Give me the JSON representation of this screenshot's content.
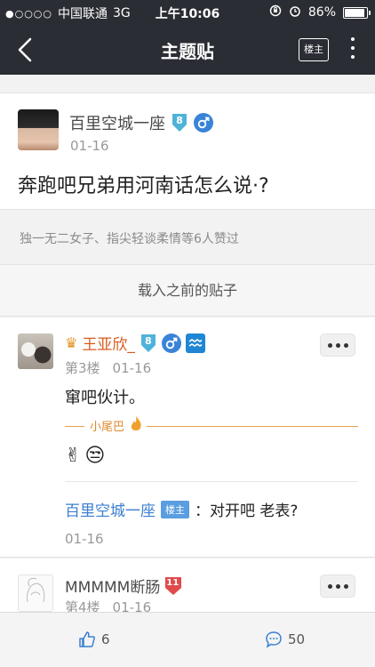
{
  "status": {
    "carrier": "中国联通",
    "network": "3G",
    "time": "上午10:06",
    "battery_text": "86%",
    "battery_level": 0.86
  },
  "nav": {
    "title": "主题贴",
    "owner_button": "楼主"
  },
  "post": {
    "author": "百里空城一座",
    "level": "8",
    "date": "01-16",
    "title": "奔跑吧兄弟用河南话怎么说·?"
  },
  "likes": {
    "names": "独一无二女子、指尖轻谈柔情",
    "suffix": "等6人赞过"
  },
  "load_previous": "载入之前的贴子",
  "reply1": {
    "author": "王亚欣_",
    "level": "8",
    "floor": "第3楼",
    "date": "01-16",
    "content": "窜吧伙计。",
    "tail_label": "小尾巴",
    "emojis": "✌😒",
    "quote": {
      "name": "百里空城一座",
      "badge": "楼主",
      "text": "：对开吧 老表?",
      "date": "01-16"
    }
  },
  "reply2": {
    "author": "MMMMM断肠",
    "level": "11",
    "floor": "第4楼",
    "date": "01-16"
  },
  "bottom": {
    "likes": "6",
    "comments": "50"
  },
  "colors": {
    "nav_bg": "#2a2d33",
    "link_blue": "#3a7fd0",
    "vip_orange": "#d85a1f",
    "level_badge": "#4fb3d9"
  },
  "icons": [
    "back-arrow-icon",
    "more-vertical-icon",
    "level-badge-icon",
    "male-icon",
    "aquarius-icon",
    "crown-icon",
    "thumb-up-icon",
    "comment-icon"
  ]
}
